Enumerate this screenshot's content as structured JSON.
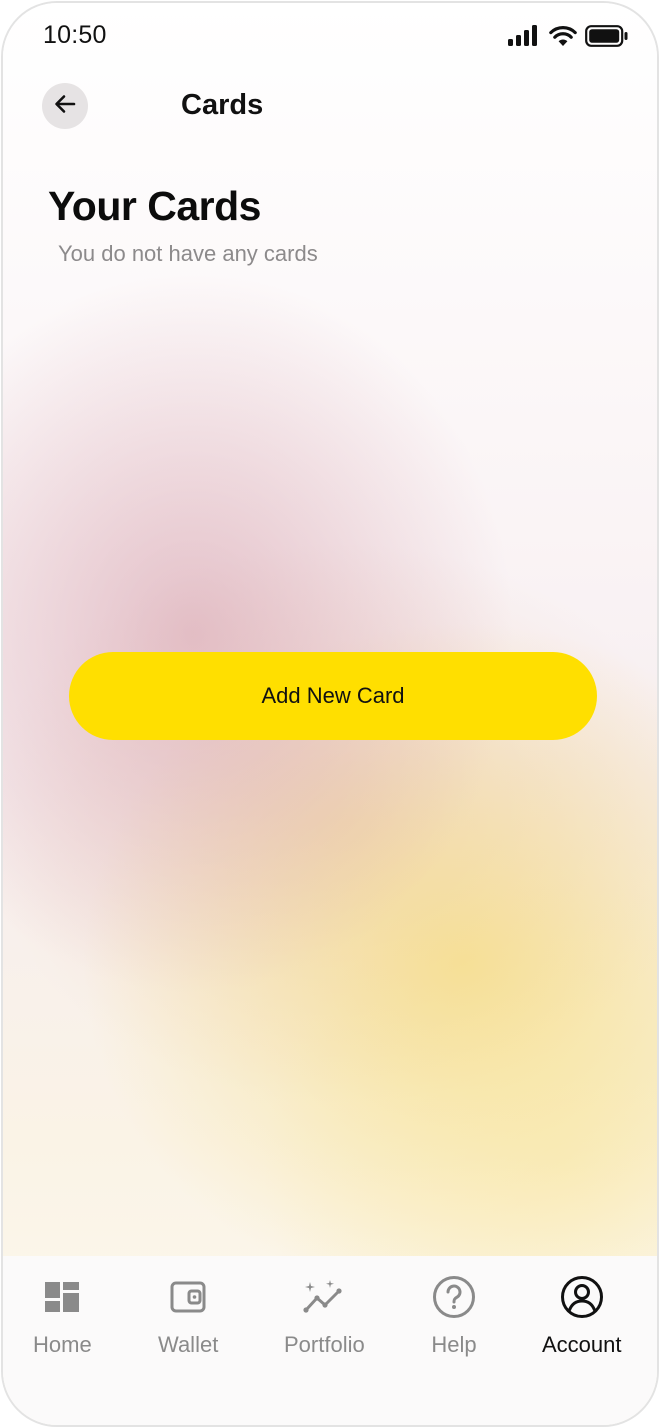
{
  "status_bar": {
    "time": "10:50",
    "icons": [
      "signal-icon",
      "wifi-icon",
      "battery-icon"
    ]
  },
  "header": {
    "back_icon": "arrow-left-icon",
    "title": "Cards"
  },
  "cards_section": {
    "title": "Your Cards",
    "empty_message": "You do not have any cards"
  },
  "add_card_button": {
    "label": "Add New Card",
    "color": "#FFDF00"
  },
  "bottom_nav": {
    "items": [
      {
        "label": "Home",
        "icon": "dashboard-grid-icon",
        "active": false
      },
      {
        "label": "Wallet",
        "icon": "wallet-icon",
        "active": false
      },
      {
        "label": "Portfolio",
        "icon": "chart-sparkle-icon",
        "active": false
      },
      {
        "label": "Help",
        "icon": "question-circle-icon",
        "active": false
      },
      {
        "label": "Account",
        "icon": "user-circle-icon",
        "active": true
      }
    ],
    "active_color": "#111111",
    "inactive_color": "#8A8A8A"
  }
}
